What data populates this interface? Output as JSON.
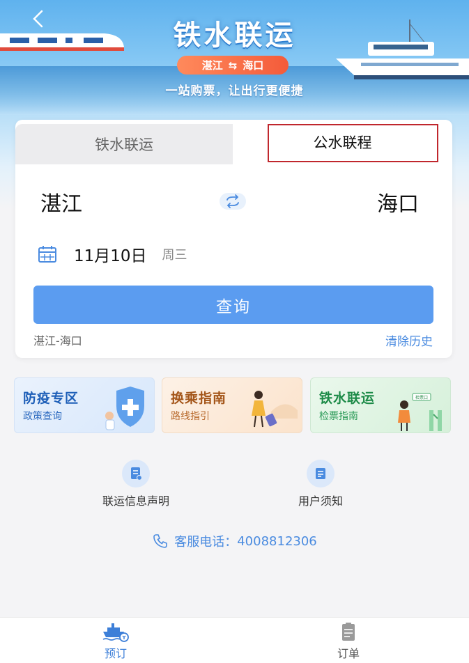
{
  "banner": {
    "title": "铁水联运",
    "route_from": "湛江",
    "route_to": "海口",
    "slogan": "一站购票，让出行更便捷"
  },
  "tabs": [
    {
      "label": "铁水联运",
      "active": false
    },
    {
      "label": "公水联程",
      "active": true
    }
  ],
  "booking": {
    "from_city": "湛江",
    "to_city": "海口",
    "date": "11月10日",
    "weekday": "周三",
    "search_label": "查询",
    "history_item": "湛江-海口",
    "clear_history": "清除历史"
  },
  "promos": [
    {
      "title": "防疫专区",
      "subtitle": "政策查询"
    },
    {
      "title": "换乘指南",
      "subtitle": "路线指引"
    },
    {
      "title": "铁水联运",
      "subtitle": "检票指南",
      "sign_text": "检票口"
    }
  ],
  "info_links": [
    {
      "label": "联运信息声明",
      "icon": "document-icon"
    },
    {
      "label": "用户须知",
      "icon": "notice-icon"
    }
  ],
  "hotline": {
    "label": "客服电话：",
    "number": "4008812306"
  },
  "bottom_nav": [
    {
      "label": "预订",
      "icon": "ship-ticket-icon",
      "active": true
    },
    {
      "label": "订单",
      "icon": "clipboard-icon",
      "active": false
    }
  ],
  "colors": {
    "primary": "#5b9cf0",
    "accent_blue": "#4a8be0",
    "highlight_red": "#c0272d",
    "pill_orange": "#f45b3a"
  }
}
